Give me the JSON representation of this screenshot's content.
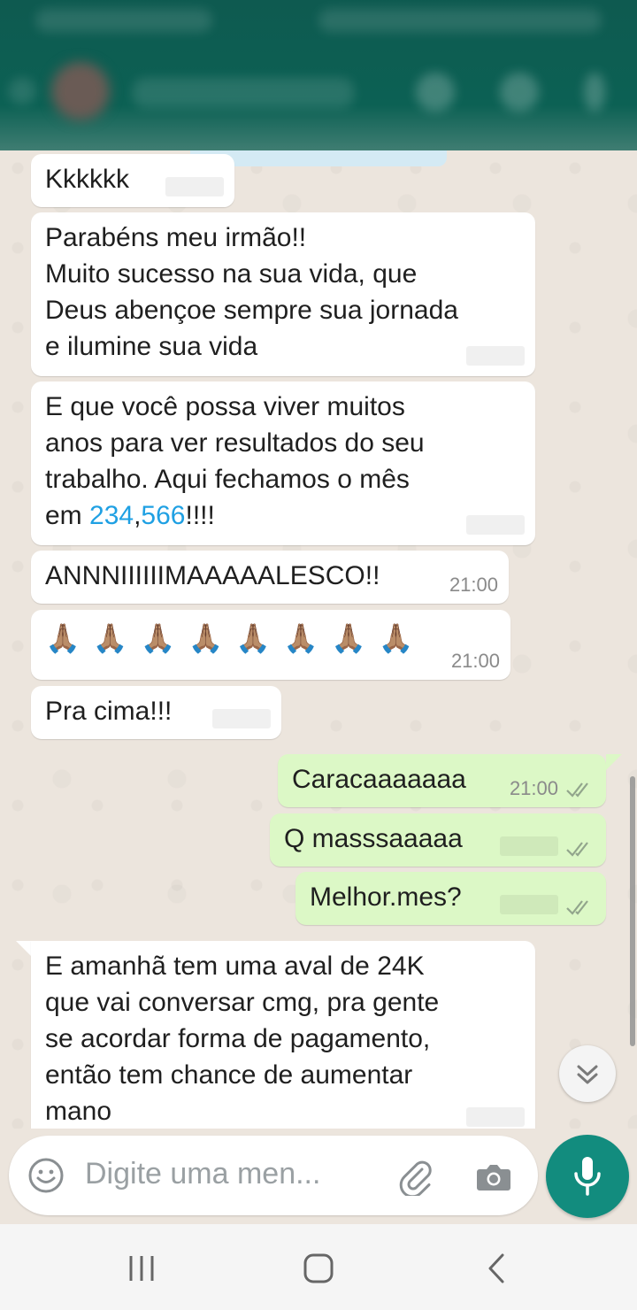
{
  "messages": [
    {
      "text": "Kkkkkk"
    },
    {
      "text": "Parabéns meu irmão!!\nMuito sucesso na sua vida, que\nDeus abençoe sempre sua jornada\ne ilumine sua vida"
    },
    {
      "line1": "E que você possa viver muitos",
      "line2": "anos para ver resultados do seu",
      "line3": "trabalho. Aqui fechamos o mês",
      "line4_pre": "em ",
      "num_a": "234",
      "comma": ",",
      "num_b": "566",
      "line4_post": "!!!!"
    },
    {
      "text": "ANNNIIIIIIMAAAAALESCO!!",
      "time": "21:00"
    },
    {
      "text": "🙏🏽🙏🏽🙏🏽🙏🏽🙏🏽🙏🏽🙏🏽🙏🏽",
      "time": "21:00"
    },
    {
      "text": "Pra cima!!!"
    },
    {
      "text": "Caracaaaaaaa",
      "time": "21:00"
    },
    {
      "text": "Q masssaaaaa"
    },
    {
      "text": "Melhor.mes?"
    },
    {
      "text": "E amanhã tem uma aval de 24K\nque vai conversar cmg, pra gente\nse acordar forma de pagamento,\nentão tem chance de aumentar\nmano"
    }
  ],
  "input": {
    "placeholder": "Digite uma men..."
  },
  "icons": {
    "emoji": "emoji-icon",
    "attach": "paperclip-icon",
    "camera": "camera-icon",
    "mic": "mic-icon",
    "scroll": "chevron-double-down-icon",
    "ticks": "double-check-icon"
  },
  "colors": {
    "header": "#0c6154",
    "chat_bg": "#ece5dd",
    "incoming_bubble": "#ffffff",
    "outgoing_bubble": "#dcf8c6",
    "link": "#1fa0e3",
    "mic_button": "#128c7e"
  }
}
